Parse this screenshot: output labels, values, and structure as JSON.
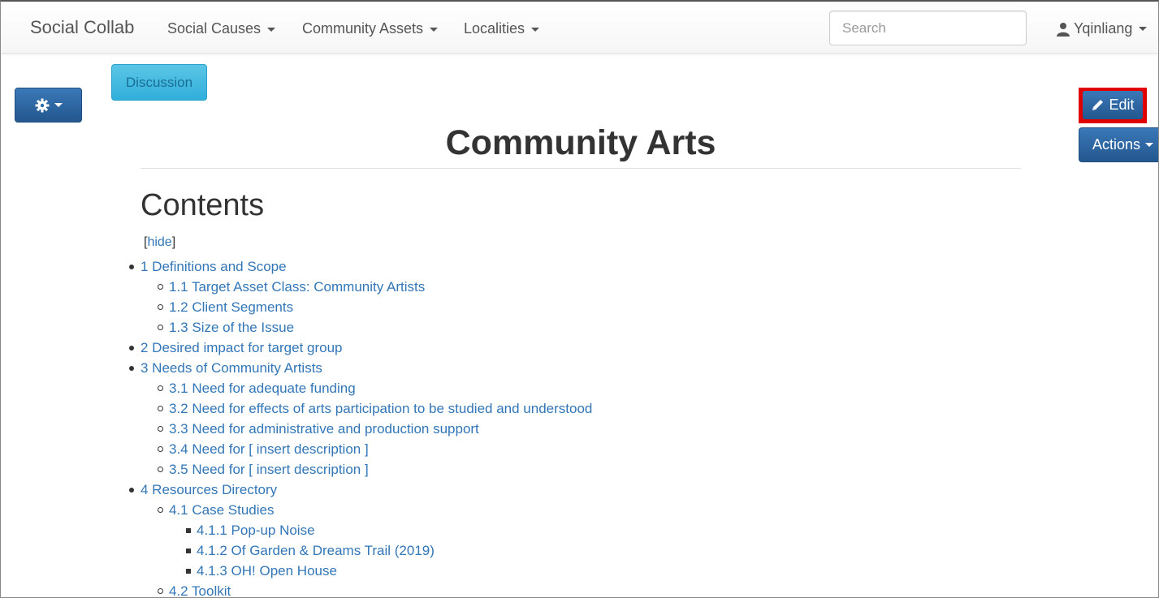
{
  "navbar": {
    "brand": "Social Collab",
    "menus": [
      "Social Causes",
      "Community Assets",
      "Localities"
    ],
    "search_placeholder": "Search",
    "user": "Yqinliang"
  },
  "buttons": {
    "discussion": "Discussion",
    "edit": "Edit",
    "actions": "Actions"
  },
  "page": {
    "title": "Community Arts",
    "contents_heading": "Contents",
    "hide_label": "hide"
  },
  "toc": [
    {
      "level": 1,
      "label": "1 Definitions and Scope"
    },
    {
      "level": 2,
      "label": "1.1 Target Asset Class: Community Artists"
    },
    {
      "level": 2,
      "label": "1.2 Client Segments"
    },
    {
      "level": 2,
      "label": "1.3 Size of the Issue"
    },
    {
      "level": 1,
      "label": "2 Desired impact for target group"
    },
    {
      "level": 1,
      "label": "3 Needs of Community Artists"
    },
    {
      "level": 2,
      "label": "3.1 Need for adequate funding"
    },
    {
      "level": 2,
      "label": "3.2 Need for effects of arts participation to be studied and understood"
    },
    {
      "level": 2,
      "label": "3.3 Need for administrative and production support"
    },
    {
      "level": 2,
      "label": "3.4 Need for [ insert description ]"
    },
    {
      "level": 2,
      "label": "3.5 Need for [ insert description ]"
    },
    {
      "level": 1,
      "label": "4 Resources Directory"
    },
    {
      "level": 2,
      "label": "4.1 Case Studies"
    },
    {
      "level": 3,
      "label": "4.1.1 Pop-up Noise"
    },
    {
      "level": 3,
      "label": "4.1.2 Of Garden & Dreams Trail (2019)"
    },
    {
      "level": 3,
      "label": "4.1.3 OH! Open House"
    },
    {
      "level": 2,
      "label": "4.2 Toolkit"
    }
  ],
  "colors": {
    "link": "#3276b7",
    "primary": "#2d6aa8",
    "info": "#3bb4df",
    "highlight": "#e00000"
  }
}
